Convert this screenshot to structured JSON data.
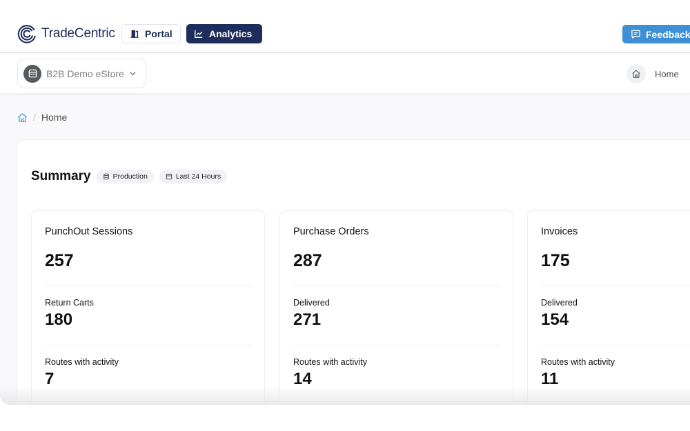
{
  "topbar": {
    "brand": "TradeCentric",
    "nav": [
      {
        "label": "Portal",
        "icon": "door-icon",
        "active": false
      },
      {
        "label": "Analytics",
        "icon": "chart-line-icon",
        "active": true
      }
    ],
    "feedback_label": "Feedback",
    "colors": {
      "brand": "#1c2a55",
      "active_nav": "#1f2d5c",
      "feedback": "#3d8fd6"
    }
  },
  "subbar": {
    "store_label": "B2B Demo eStore",
    "home_label": "Home"
  },
  "breadcrumb": {
    "separator": "/",
    "current": "Home"
  },
  "summary": {
    "title": "Summary",
    "chips": [
      {
        "label": "Production",
        "icon": "database-icon"
      },
      {
        "label": "Last 24 Hours",
        "icon": "calendar-icon"
      }
    ],
    "cards": [
      {
        "title": "PunchOut Sessions",
        "value": "257",
        "stats": [
          {
            "label": "Return Carts",
            "value": "180"
          },
          {
            "label": "Routes with activity",
            "value": "7"
          }
        ]
      },
      {
        "title": "Purchase Orders",
        "value": "287",
        "stats": [
          {
            "label": "Delivered",
            "value": "271"
          },
          {
            "label": "Routes with activity",
            "value": "14"
          }
        ]
      },
      {
        "title": "Invoices",
        "value": "175",
        "stats": [
          {
            "label": "Delivered",
            "value": "154"
          },
          {
            "label": "Routes with activity",
            "value": "11"
          }
        ]
      }
    ]
  }
}
